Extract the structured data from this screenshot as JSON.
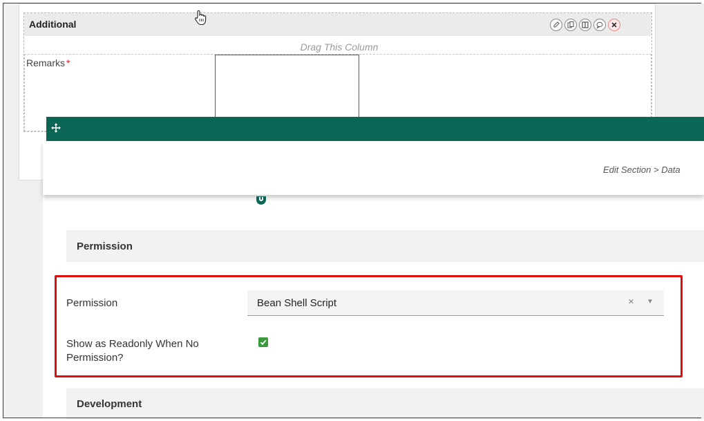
{
  "builder": {
    "section_title": "Additional",
    "drag_column_hint": "Drag This Column",
    "remarks_label": "Remarks",
    "required_marker": "*",
    "toolbar_icons": [
      "edit-icon",
      "copy-icon",
      "columns-icon",
      "comment-icon",
      "close-icon"
    ]
  },
  "dialog": {
    "breadcrumb": "Edit Section > Data"
  },
  "permission_section": {
    "heading": "Permission",
    "permission_label": "Permission",
    "permission_value": "Bean Shell Script",
    "clear_glyph": "×",
    "arrow_glyph": "▼",
    "readonly_label": "Show as Readonly When No Permission?",
    "readonly_checked": true
  },
  "development_section": {
    "heading": "Development"
  },
  "colors": {
    "dialog_bar": "#0c6656",
    "highlight_border": "#e30d0d",
    "checkbox": "#3b9a3b"
  }
}
